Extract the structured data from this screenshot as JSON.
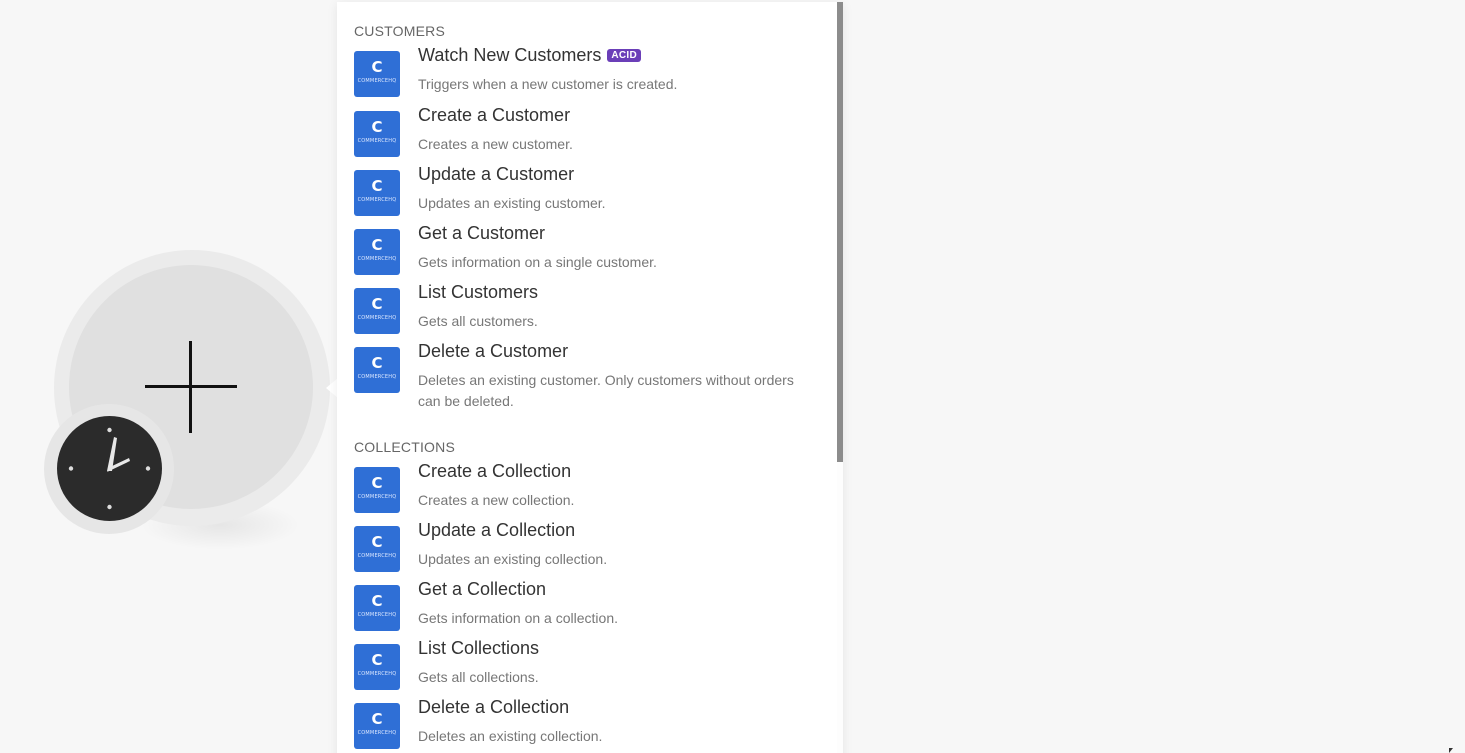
{
  "app": {
    "trigger_module": {
      "icon": "plus-icon"
    },
    "clock_badge": {
      "icon": "clock-icon"
    },
    "icon_brand_text": "COMMERCEHQ",
    "icon_glyph": "C"
  },
  "panel": {
    "sections": [
      {
        "header": "CUSTOMERS",
        "items": [
          {
            "title": "Watch New Customers",
            "badge": "ACID",
            "desc": "Triggers when a new customer is created."
          },
          {
            "title": "Create a Customer",
            "desc": "Creates a new customer."
          },
          {
            "title": "Update a Customer",
            "desc": "Updates an existing customer."
          },
          {
            "title": "Get a Customer",
            "desc": "Gets information on a single customer."
          },
          {
            "title": "List Customers",
            "desc": "Gets all customers."
          },
          {
            "title": "Delete a Customer",
            "desc": "Deletes an existing customer. Only customers without orders can be deleted."
          }
        ]
      },
      {
        "header": "COLLECTIONS",
        "items": [
          {
            "title": "Create a Collection",
            "desc": "Creates a new collection."
          },
          {
            "title": "Update a Collection",
            "desc": "Updates an existing collection."
          },
          {
            "title": "Get a Collection",
            "desc": "Gets information on a collection."
          },
          {
            "title": "List Collections",
            "desc": "Gets all collections."
          },
          {
            "title": "Delete a Collection",
            "desc": "Deletes an existing collection."
          }
        ]
      }
    ]
  },
  "colors": {
    "app_icon": "#2f6fd6",
    "badge": "#6b3fb8",
    "background": "#f7f7f7"
  }
}
